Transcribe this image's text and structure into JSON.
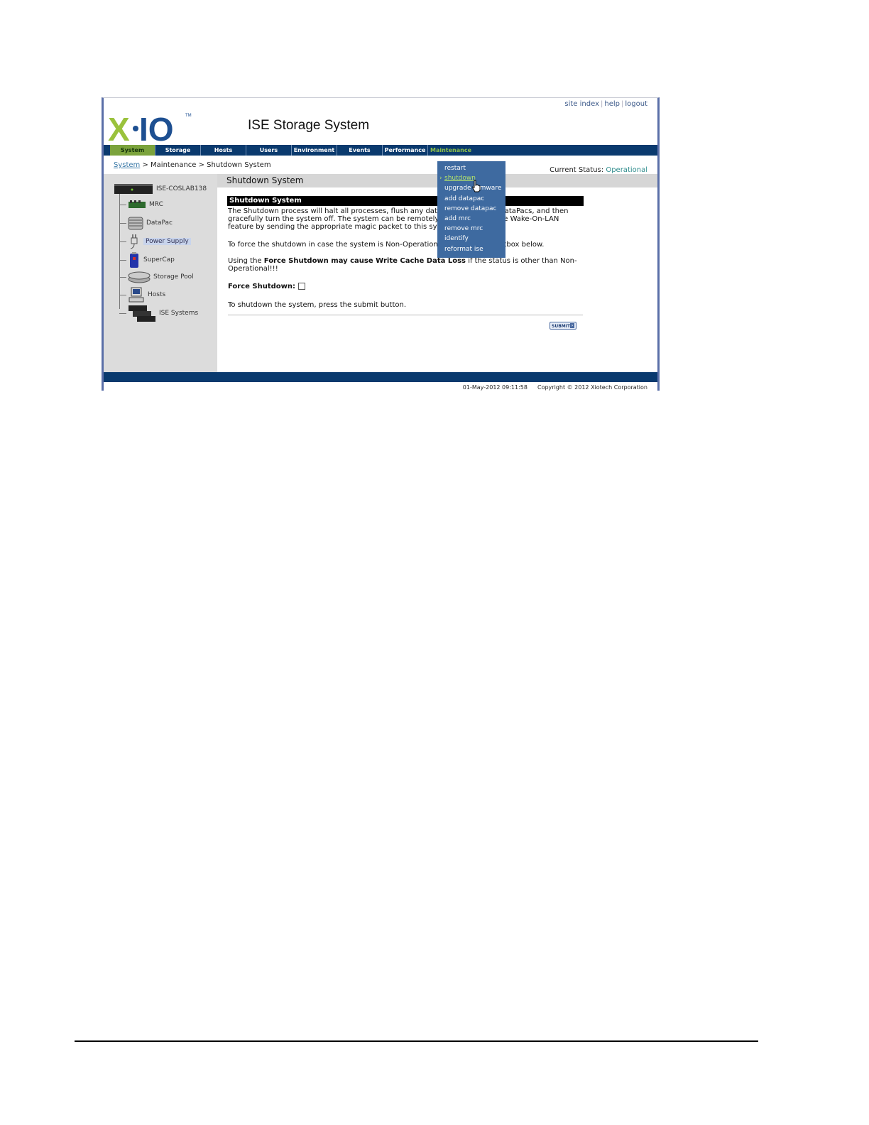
{
  "header": {
    "links": [
      "site index",
      "help",
      "logout"
    ],
    "logo_text": "X·IO",
    "trademark": "TM",
    "app_title": "ISE Storage System"
  },
  "nav": {
    "tabs": [
      "System",
      "Storage",
      "Hosts",
      "Users",
      "Environment",
      "Events",
      "Performance",
      "Maintenance"
    ],
    "active": "System"
  },
  "breadcrumb": {
    "root": "System",
    "rest": " > Maintenance > Shutdown System"
  },
  "status": {
    "label": "Current Status:",
    "value": "Operational"
  },
  "sidebar": {
    "items": [
      "ISE-COSLAB138",
      "MRC",
      "DataPac",
      "Power Supply",
      "SuperCap",
      "Storage Pool",
      "Hosts",
      "ISE Systems"
    ],
    "highlighted": "Power Supply"
  },
  "main": {
    "header": "Shutdown System",
    "section_title": "Shutdown System",
    "para1": "The Shutdown process will halt all processes, flush any data in cache to the DataPacs, and then gracefully turn the system off. The system can be remotely powered on by the Wake-On-LAN feature by sending the appropriate magic packet to this system.",
    "para2": "To force the shutdown in case the system is Non-Operational, check the checkbox below.",
    "para3_prefix": "Using the ",
    "para3_bold": "Force Shutdown may cause Write Cache Data Loss",
    "para3_suffix": " if the status is other than Non-Operational!!!",
    "force_label": "Force Shutdown:",
    "force_checked": false,
    "instruction": "To shutdown the system, press the submit button.",
    "submit_label": "SUBMIT"
  },
  "menu": {
    "items": [
      "restart",
      "shutdown",
      "upgrade firmware",
      "add datapac",
      "remove datapac",
      "add mrc",
      "remove mrc",
      "identify",
      "reformat ise"
    ],
    "selected": "shutdown"
  },
  "footer": {
    "timestamp": "01-May-2012 09:11:58",
    "copyright": "Copyright © 2012 Xiotech Corporation"
  },
  "colors": {
    "nav_bg": "#0a3a6e",
    "active_tab": "#7ba33c",
    "menu_bg": "#3e6aa0",
    "logo_green": "#9ac23c",
    "logo_blue": "#1d4f91",
    "status_ok": "#2e8c8c"
  }
}
